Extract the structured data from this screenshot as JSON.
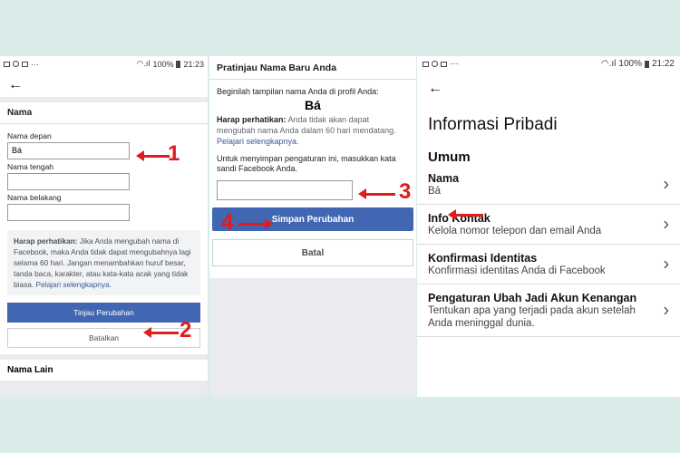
{
  "status_left": {
    "time": "21:23",
    "battery": "100%",
    "more": "···"
  },
  "status_right": {
    "time": "21:22",
    "battery": "100%",
    "more": "···"
  },
  "panel1": {
    "section_title": "Nama",
    "first_label": "Nama depan",
    "first_value": "Bá",
    "middle_label": "Nama tengah",
    "last_label": "Nama belakang",
    "note_bold": "Harap perhatikan:",
    "note_text": " Jika Anda mengubah nama di Facebook, maka Anda tidak dapat mengubahnya lagi selama 60 hari. Jangan menambahkan huruf besar, tanda baca, karakter, atau kata-kata acak yang tidak biasa. ",
    "note_link": "Pelajari selengkapnya.",
    "review_button": "Tinjau Perubahan",
    "cancel_button": "Batalkan",
    "other_names": "Nama Lain"
  },
  "panel2": {
    "title": "Pratinjau Nama Baru Anda",
    "intro": "Beginilah tampilan nama Anda di profil Anda:",
    "preview_name": "Bá",
    "warn_bold": "Harap perhatikan:",
    "warn_text": " Anda tidak akan dapat mengubah nama Anda dalam 60 hari mendatang. ",
    "warn_link": "Pelajari selengkapnya.",
    "password_prompt": "Untuk menyimpan pengaturan ini, masukkan kata sandi Facebook Anda.",
    "save_button": "Simpan Perubahan",
    "cancel_button": "Batal"
  },
  "panel3": {
    "title": "Informasi Pribadi",
    "section": "Umum",
    "rows": [
      {
        "title": "Nama",
        "sub": "Bá"
      },
      {
        "title": "Info Kontak",
        "sub": "Kelola nomor telepon dan email Anda"
      },
      {
        "title": "Konfirmasi Identitas",
        "sub": "Konfirmasi identitas Anda di Facebook"
      },
      {
        "title": "Pengaturan Ubah Jadi Akun Kenangan",
        "sub": "Tentukan apa yang terjadi pada akun setelah Anda meninggal dunia."
      }
    ]
  },
  "annotations": {
    "n1": "1",
    "n2": "2",
    "n3": "3",
    "n4": "4"
  },
  "colors": {
    "accent": "#4267b2",
    "annotation": "#e21b1b",
    "background": "#d9ecea"
  }
}
